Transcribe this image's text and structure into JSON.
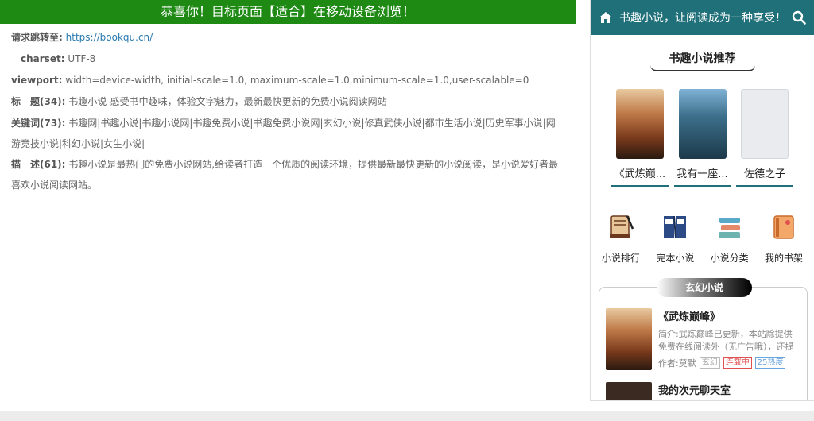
{
  "banner": "恭喜你！目标页面【适合】在移动设备浏览！",
  "info": {
    "redirect_label": "请求跳转至:",
    "redirect_url": "https://bookqu.cn/",
    "charset_label": "charset:",
    "charset_value": "UTF-8",
    "viewport_label": "viewport:",
    "viewport_value": "width=device-width, initial-scale=1.0, maximum-scale=1.0,minimum-scale=1.0,user-scalable=0",
    "title_label": "标　题(34):",
    "title_value": "书趣小说-感受书中趣味，体验文字魅力，最新最快更新的免费小说阅读网站",
    "keywords_label": "关键词(73):",
    "keywords_value": "书趣网|书趣小说|书趣小说网|书趣免费小说|书趣免费小说网|玄幻小说|修真武侠小说|都市生活小说|历史军事小说|网游竞技小说|科幻小说|女生小说|",
    "desc_label": "描　述(61):",
    "desc_value": "书趣小说是最热门的免费小说网站,给读者打造一个优质的阅读环境，提供最新最快更新的小说阅读，是小说爱好者最喜欢小说阅读网站。"
  },
  "mobile": {
    "header_title": "书趣小说，让阅读成为一种享受！",
    "section_title": "书趣小说推荐",
    "books": [
      {
        "name": "《武炼巅..."
      },
      {
        "name": "我有一座..."
      },
      {
        "name": "佐德之子"
      }
    ],
    "shortcuts": [
      {
        "label": "小说排行",
        "icon": "scroll-icon"
      },
      {
        "label": "完本小说",
        "icon": "books-icon"
      },
      {
        "label": "小说分类",
        "icon": "stack-icon"
      },
      {
        "label": "我的书架",
        "icon": "bookmark-icon"
      }
    ],
    "card": {
      "category": "玄幻小说",
      "item_title": "《武炼巅峰》",
      "item_desc": "简介:武炼巅峰已更新，本站除提供免费在线阅读外（无广告哦），还提供",
      "author": "作者:莫默",
      "tags": [
        "玄幻",
        "连载中",
        "25热度"
      ],
      "next_title": "我的次元聊天室"
    }
  },
  "colors": {
    "banner": "#1e8a14",
    "mobile_header": "#20707a"
  }
}
